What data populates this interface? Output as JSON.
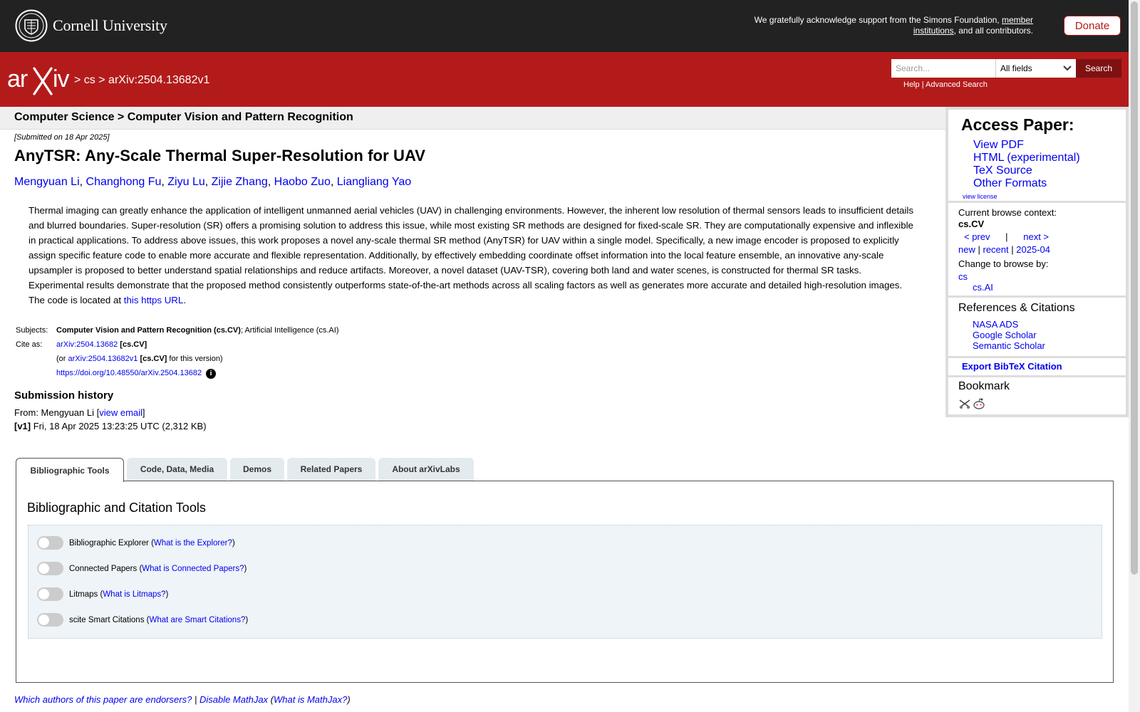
{
  "header": {
    "university": "Cornell University",
    "support_prefix": "We gratefully acknowledge support from the Simons Foundation,",
    "support_link": "member institutions",
    "support_suffix": ", and all contributors.",
    "donate_label": "Donate"
  },
  "nav": {
    "crumb_cs": "cs",
    "crumb_sep": ">",
    "crumb_id": "arXiv:2504.13682v1",
    "search_placeholder": "Search...",
    "field_selected": "All fields",
    "search_label": "Search",
    "help_label": "Help",
    "link_sep": "|",
    "advanced_label": "Advanced Search"
  },
  "subject_heading": "Computer Science > Computer Vision and Pattern Recognition",
  "paper": {
    "submitted": "[Submitted on 18 Apr 2025]",
    "title": "AnyTSR: Any-Scale Thermal Super-Resolution for UAV",
    "authors": [
      "Mengyuan Li",
      "Changhong Fu",
      "Ziyu Lu",
      "Zijie Zhang",
      "Haobo Zuo",
      "Liangliang Yao"
    ],
    "abstract_text": "Thermal imaging can greatly enhance the application of intelligent unmanned aerial vehicles (UAV) in challenging environments. However, the inherent low resolution of thermal sensors leads to insufficient details and blurred boundaries. Super-resolution (SR) offers a promising solution to address this issue, while most existing SR methods are designed for fixed-scale SR. They are computationally expensive and inflexible in practical applications. To address above issues, this work proposes a novel any-scale thermal SR method (AnyTSR) for UAV within a single model. Specifically, a new image encoder is proposed to explicitly assign specific feature code to enable more accurate and flexible representation. Additionally, by effectively embedding coordinate offset information into the local feature ensemble, an innovative any-scale upsampler is proposed to better understand spatial relationships and reduce artifacts. Moreover, a novel dataset (UAV-TSR), covering both land and water scenes, is constructed for thermal SR tasks. Experimental results demonstrate that the proposed method consistently outperforms state-of-the-art methods across all scaling factors as well as generates more accurate and detailed high-resolution images. The code is located at ",
    "abstract_link": "this https URL",
    "abstract_end": "."
  },
  "meta": {
    "subjects_label": "Subjects:",
    "subject_primary": "Computer Vision and Pattern Recognition (cs.CV)",
    "subject_secondary": "; Artificial Intelligence (cs.AI)",
    "cite_label": "Cite as:",
    "cite_id": "arXiv:2504.13682",
    "cite_tag": "[cs.CV]",
    "cite_or": "(or",
    "cite_version_id": "arXiv:2504.13682v1",
    "cite_version_suffix": "for this version)",
    "doi": "https://doi.org/10.48550/arXiv.2504.13682",
    "info_icon": "i"
  },
  "history": {
    "title": "Submission history",
    "from_prefix": "From: Mengyuan Li [",
    "view_email": "view email",
    "from_suffix": "]",
    "v1_label": "[v1]",
    "v1_text": " Fri, 18 Apr 2025 13:23:25 UTC (2,312 KB)"
  },
  "sidebar": {
    "access_title": "Access Paper:",
    "access_links": [
      "View PDF",
      "HTML (experimental)",
      "TeX Source",
      "Other Formats"
    ],
    "view_license": "view license",
    "browse_label": "Current browse context:",
    "browse_context": "cs.CV",
    "prev": "< prev",
    "next": "next >",
    "new": "new",
    "recent": "recent",
    "month": "2025-04",
    "change_label": "Change to browse by:",
    "browse_cs": "cs",
    "browse_csai": "cs.AI",
    "refs_title": "References & Citations",
    "refs_links": [
      "NASA ADS",
      "Google Scholar",
      "Semantic Scholar"
    ],
    "bibtex": "Export BibTeX Citation",
    "bookmark_title": "Bookmark",
    "bookmark_icons": [
      "bibsonomy-icon",
      "reddit-icon"
    ]
  },
  "tabs": [
    "Bibliographic Tools",
    "Code, Data, Media",
    "Demos",
    "Related Papers",
    "About arXivLabs"
  ],
  "tools": {
    "panel_title": "Bibliographic and Citation Tools",
    "items": [
      {
        "name": "Bibliographic Explorer",
        "link": "What is the Explorer?"
      },
      {
        "name": "Connected Papers",
        "link": "What is Connected Papers?"
      },
      {
        "name": "Litmaps",
        "link": "What is Litmaps?"
      },
      {
        "name": "scite Smart Citations",
        "link": "What are Smart Citations?"
      }
    ]
  },
  "footer": {
    "endorsers": "Which authors of this paper are endorsers?",
    "sep": "|",
    "disable_mathjax": "Disable MathJax",
    "what_mathjax": "What is MathJax?"
  },
  "colors": {
    "arxiv_red": "#b31b1b",
    "top_bar": "#222222",
    "link_blue": "#0000ee"
  }
}
